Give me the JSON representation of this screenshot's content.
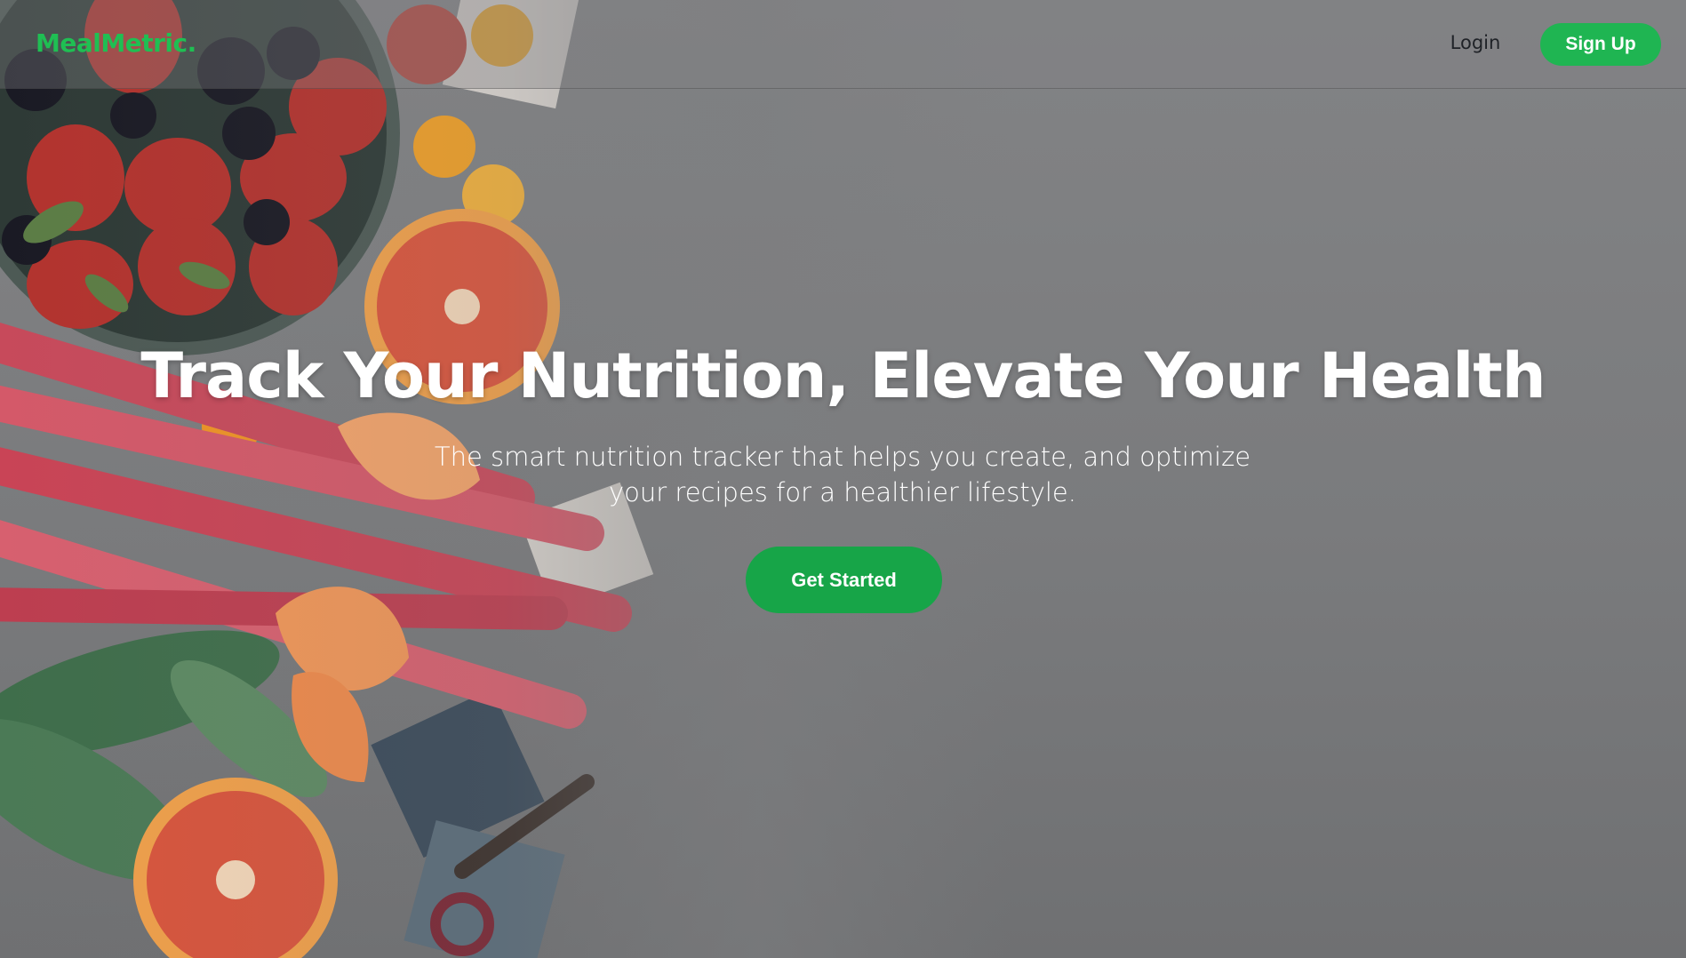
{
  "brand": {
    "name": "MealMetric.",
    "accent": "#1fbf53"
  },
  "nav": {
    "login_label": "Login",
    "signup_label": "Sign Up"
  },
  "hero": {
    "headline": "Track Your Nutrition, Elevate Your Health",
    "subtitle_line1": "The smart nutrition tracker that helps you create, and optimize",
    "subtitle_line2": "your recipes for a healthier lifestyle.",
    "cta_label": "Get Started",
    "cta_color": "#17a548"
  }
}
